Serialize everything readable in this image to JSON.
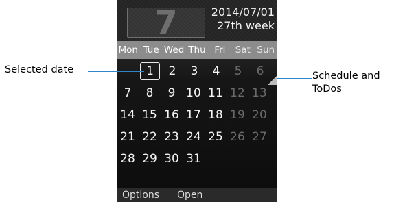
{
  "calendar": {
    "month": "7",
    "date": "2014/07/01",
    "week": "27th week",
    "weekdays": [
      "Mon",
      "Tue",
      "Wed",
      "Thu",
      "Fri",
      "Sat",
      "Sun"
    ],
    "weeks": [
      [
        "",
        "1",
        "2",
        "3",
        "4",
        "5",
        "6"
      ],
      [
        "7",
        "8",
        "9",
        "10",
        "11",
        "12",
        "13"
      ],
      [
        "14",
        "15",
        "16",
        "17",
        "18",
        "19",
        "20"
      ],
      [
        "21",
        "22",
        "23",
        "24",
        "25",
        "26",
        "27"
      ],
      [
        "28",
        "29",
        "30",
        "31",
        "",
        "",
        ""
      ]
    ],
    "selected_day": "1"
  },
  "softkeys": {
    "left": "Options",
    "center": "Open"
  },
  "annotations": {
    "selected_date": "Selected date",
    "schedule_line1": "Schedule and",
    "schedule_line2": "ToDos"
  },
  "colors": {
    "callout": "#2e86c8",
    "weekend": "#6a6a6a"
  }
}
